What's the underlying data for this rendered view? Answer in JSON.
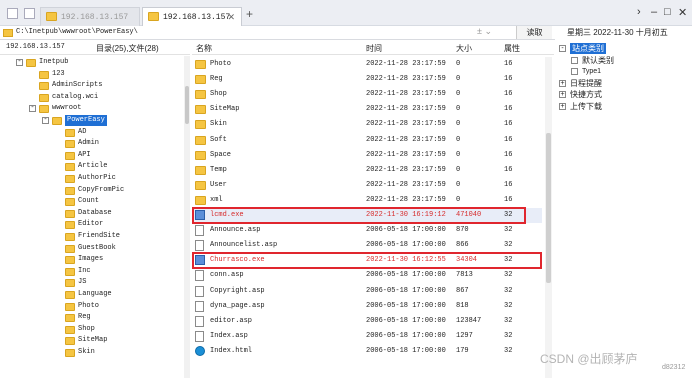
{
  "tabs": [
    {
      "title": "192.168.13.157",
      "active": false
    },
    {
      "title": "192.168.13.157",
      "active": true
    }
  ],
  "new_tab": "+",
  "window_controls": [
    "›",
    "–",
    "□",
    "✕"
  ],
  "address": {
    "path": "C:\\Inetpub\\wwwroot\\PowerEasy\\",
    "arrows": "± ⌄",
    "read_button": "读取"
  },
  "date": "星期三  2022-11-30  十月初五",
  "tree_header": {
    "ip": "192.168.13.157",
    "counts": "目录(25),文件(28)"
  },
  "tree": [
    {
      "label": "Inetpub",
      "indent": 0,
      "toggle": "-"
    },
    {
      "label": "123",
      "indent": 1,
      "toggle": ""
    },
    {
      "label": "AdminScripts",
      "indent": 1,
      "toggle": ""
    },
    {
      "label": "catalog.wci",
      "indent": 1,
      "toggle": ""
    },
    {
      "label": "wwwroot",
      "indent": 1,
      "toggle": "-"
    },
    {
      "label": "PowerEasy",
      "indent": 2,
      "toggle": "-",
      "selected": true
    },
    {
      "label": "AD",
      "indent": 3,
      "toggle": ""
    },
    {
      "label": "Admin",
      "indent": 3,
      "toggle": ""
    },
    {
      "label": "API",
      "indent": 3,
      "toggle": ""
    },
    {
      "label": "Article",
      "indent": 3,
      "toggle": ""
    },
    {
      "label": "AuthorPic",
      "indent": 3,
      "toggle": ""
    },
    {
      "label": "CopyFromPic",
      "indent": 3,
      "toggle": ""
    },
    {
      "label": "Count",
      "indent": 3,
      "toggle": ""
    },
    {
      "label": "Database",
      "indent": 3,
      "toggle": ""
    },
    {
      "label": "Editor",
      "indent": 3,
      "toggle": ""
    },
    {
      "label": "FriendSite",
      "indent": 3,
      "toggle": ""
    },
    {
      "label": "GuestBook",
      "indent": 3,
      "toggle": ""
    },
    {
      "label": "Images",
      "indent": 3,
      "toggle": ""
    },
    {
      "label": "Inc",
      "indent": 3,
      "toggle": ""
    },
    {
      "label": "JS",
      "indent": 3,
      "toggle": ""
    },
    {
      "label": "Language",
      "indent": 3,
      "toggle": ""
    },
    {
      "label": "Photo",
      "indent": 3,
      "toggle": ""
    },
    {
      "label": "Reg",
      "indent": 3,
      "toggle": ""
    },
    {
      "label": "Shop",
      "indent": 3,
      "toggle": ""
    },
    {
      "label": "SiteMap",
      "indent": 3,
      "toggle": ""
    },
    {
      "label": "Skin",
      "indent": 3,
      "toggle": ""
    }
  ],
  "columns": {
    "name": "名称",
    "time": "时间",
    "size": "大小",
    "attr": "属性"
  },
  "files": [
    {
      "name": "Photo",
      "time": "2022-11-28 23:17:59",
      "size": "0",
      "attr": "16",
      "icon": "folder"
    },
    {
      "name": "Reg",
      "time": "2022-11-28 23:17:59",
      "size": "0",
      "attr": "16",
      "icon": "folder"
    },
    {
      "name": "Shop",
      "time": "2022-11-28 23:17:59",
      "size": "0",
      "attr": "16",
      "icon": "folder"
    },
    {
      "name": "SiteMap",
      "time": "2022-11-28 23:17:59",
      "size": "0",
      "attr": "16",
      "icon": "folder"
    },
    {
      "name": "Skin",
      "time": "2022-11-28 23:17:59",
      "size": "0",
      "attr": "16",
      "icon": "folder"
    },
    {
      "name": "Soft",
      "time": "2022-11-28 23:17:59",
      "size": "0",
      "attr": "16",
      "icon": "folder"
    },
    {
      "name": "Space",
      "time": "2022-11-28 23:17:59",
      "size": "0",
      "attr": "16",
      "icon": "folder"
    },
    {
      "name": "Temp",
      "time": "2022-11-28 23:17:59",
      "size": "0",
      "attr": "16",
      "icon": "folder"
    },
    {
      "name": "User",
      "time": "2022-11-28 23:17:59",
      "size": "0",
      "attr": "16",
      "icon": "folder"
    },
    {
      "name": "xml",
      "time": "2022-11-28 23:17:59",
      "size": "0",
      "attr": "16",
      "icon": "folder"
    },
    {
      "name": "lcmd.exe",
      "time": "2022-11-30 16:19:12",
      "size": "471040",
      "attr": "32",
      "icon": "exe",
      "highlight": true
    },
    {
      "name": "Announce.asp",
      "time": "2006-05-18 17:00:00",
      "size": "870",
      "attr": "32",
      "icon": "file"
    },
    {
      "name": "Announcelist.asp",
      "time": "2006-05-18 17:00:00",
      "size": "866",
      "attr": "32",
      "icon": "file"
    },
    {
      "name": "Churrasco.exe",
      "time": "2022-11-30 16:12:55",
      "size": "34304",
      "attr": "32",
      "icon": "exe",
      "highlight": true
    },
    {
      "name": "conn.asp",
      "time": "2006-05-18 17:00:00",
      "size": "7813",
      "attr": "32",
      "icon": "file"
    },
    {
      "name": "Copyright.asp",
      "time": "2006-05-18 17:00:00",
      "size": "867",
      "attr": "32",
      "icon": "file"
    },
    {
      "name": "dyna_page.asp",
      "time": "2006-05-18 17:00:00",
      "size": "818",
      "attr": "32",
      "icon": "file"
    },
    {
      "name": "editor.asp",
      "time": "2006-05-18 17:00:00",
      "size": "123847",
      "attr": "32",
      "icon": "file"
    },
    {
      "name": "Index.asp",
      "time": "2006-05-18 17:00:00",
      "size": "1297",
      "attr": "32",
      "icon": "file"
    },
    {
      "name": "Index.html",
      "time": "2006-05-18 17:00:00",
      "size": "179",
      "attr": "32",
      "icon": "edge"
    }
  ],
  "right_panel": [
    {
      "label": "站点类别",
      "toggle": "-",
      "selected": true
    },
    {
      "label": "默认类别",
      "toggle": ""
    },
    {
      "label": "Type1",
      "toggle": ""
    },
    {
      "label": "日程提醒",
      "toggle": "+"
    },
    {
      "label": "快捷方式",
      "toggle": "+"
    },
    {
      "label": "上传下载",
      "toggle": "+"
    }
  ],
  "watermark": "CSDN @出顾茅庐",
  "watermark_small": "d82312"
}
